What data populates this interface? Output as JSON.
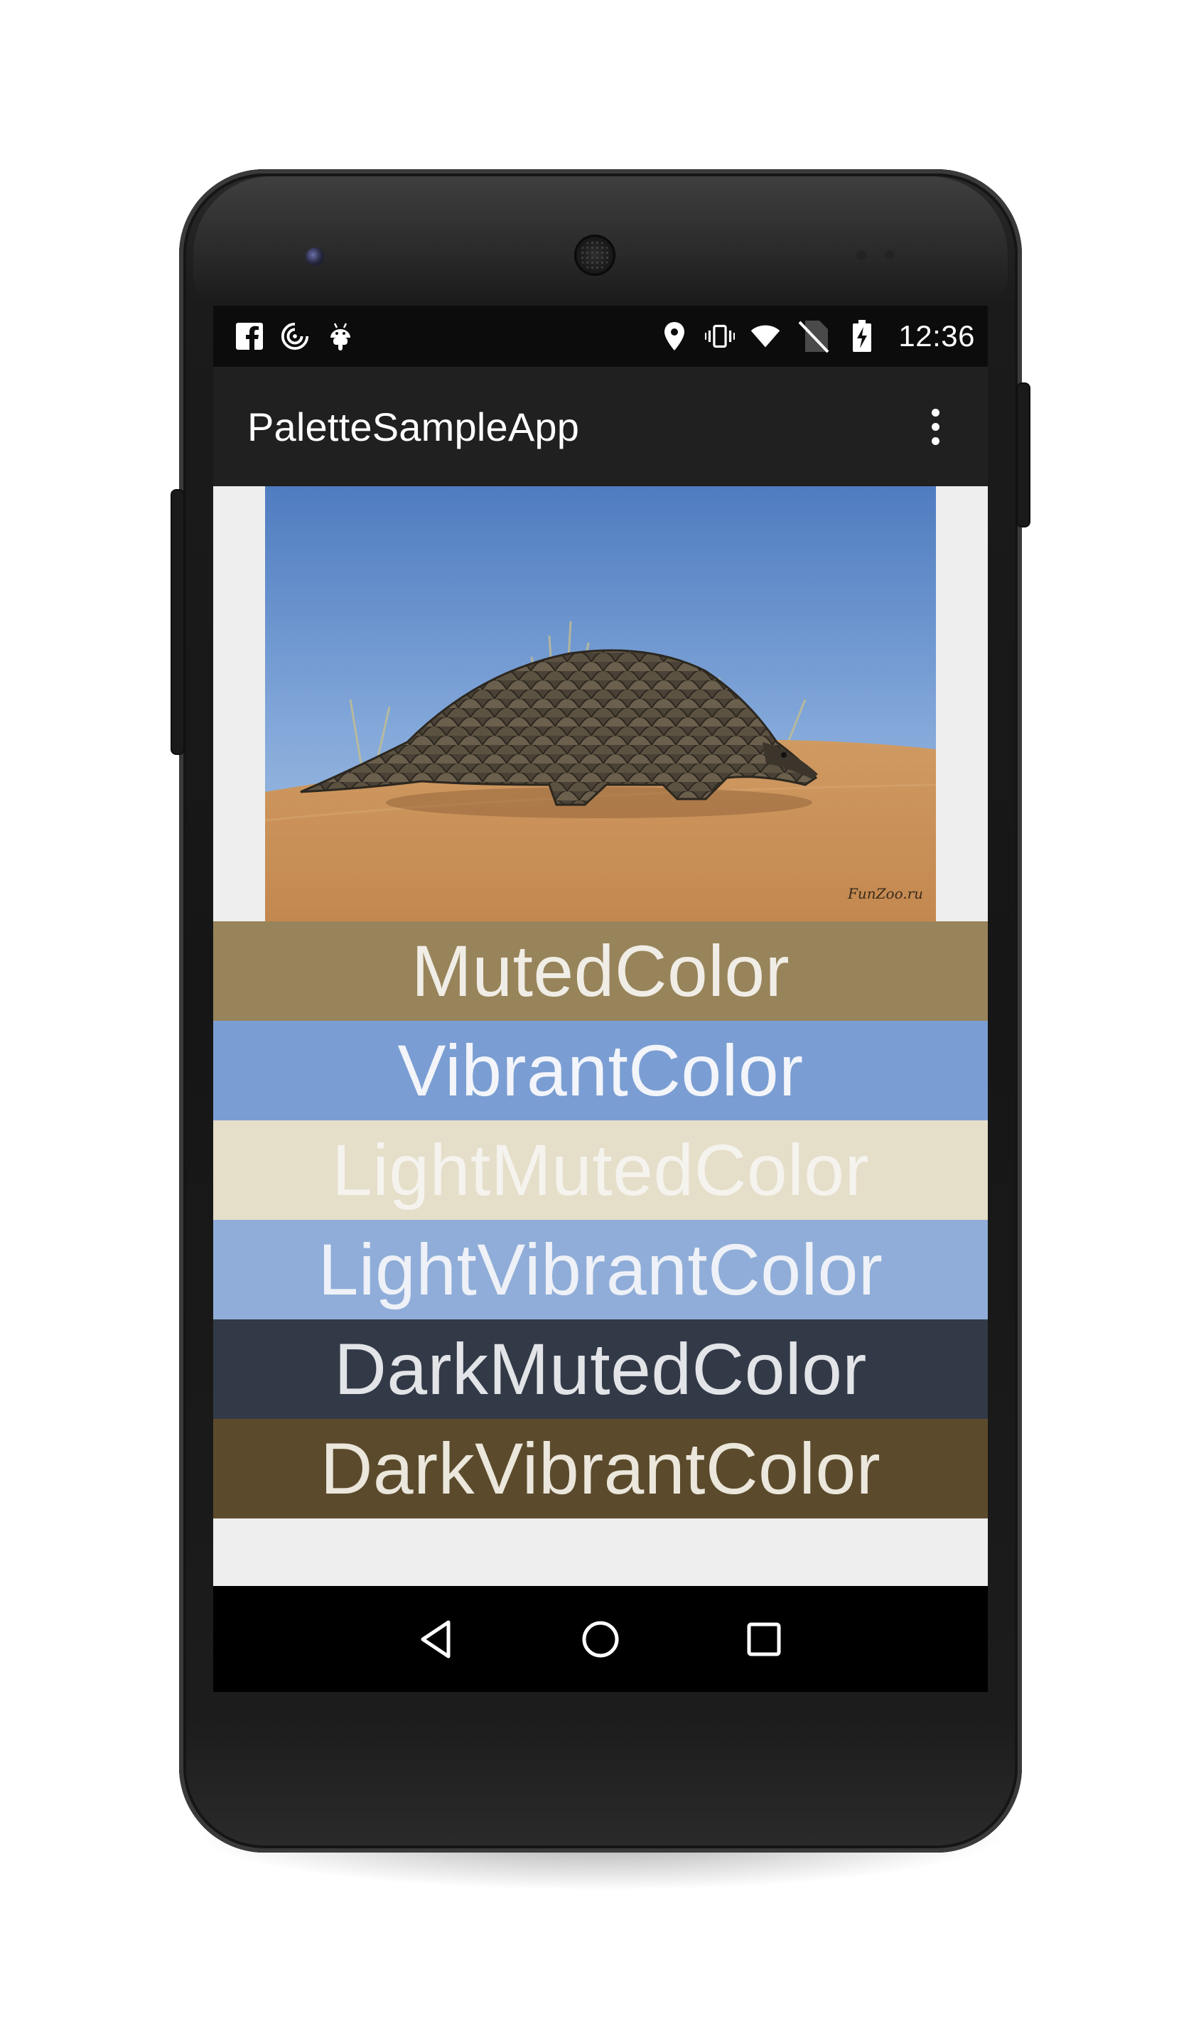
{
  "status_bar": {
    "time": "12:36",
    "left_icons": [
      "facebook-icon",
      "sync-icon",
      "android-icon"
    ],
    "right_icons": [
      "location-icon",
      "vibrate-icon",
      "wifi-icon",
      "no-sim-icon",
      "battery-charging-icon"
    ]
  },
  "toolbar": {
    "title": "PaletteSampleApp",
    "overflow_icon": "more-vert-icon"
  },
  "image": {
    "watermark": "FunZoo.ru"
  },
  "swatches": [
    {
      "label": "MutedColor",
      "bg": "#98845a",
      "fg": "#f0ede6"
    },
    {
      "label": "VibrantColor",
      "bg": "#7a9ed3",
      "fg": "#f3f5fa"
    },
    {
      "label": "LightMutedColor",
      "bg": "#e5dec9",
      "fg": "#f5f3ee"
    },
    {
      "label": "LightVibrantColor",
      "bg": "#8fadd8",
      "fg": "#eef1f7"
    },
    {
      "label": "DarkMutedColor",
      "bg": "#333a47",
      "fg": "#e3e4e8"
    },
    {
      "label": "DarkVibrantColor",
      "bg": "#5b4b2c",
      "fg": "#ece7dc"
    }
  ],
  "nav_bar": {
    "back_icon": "back-triangle-icon",
    "home_icon": "home-circle-icon",
    "recents_icon": "recents-square-icon"
  },
  "colors": {
    "status_bar_bg": "#0c0c0c",
    "toolbar_bg": "#202020",
    "content_bg": "#eeeeee",
    "nav_bar_bg": "#000000"
  }
}
